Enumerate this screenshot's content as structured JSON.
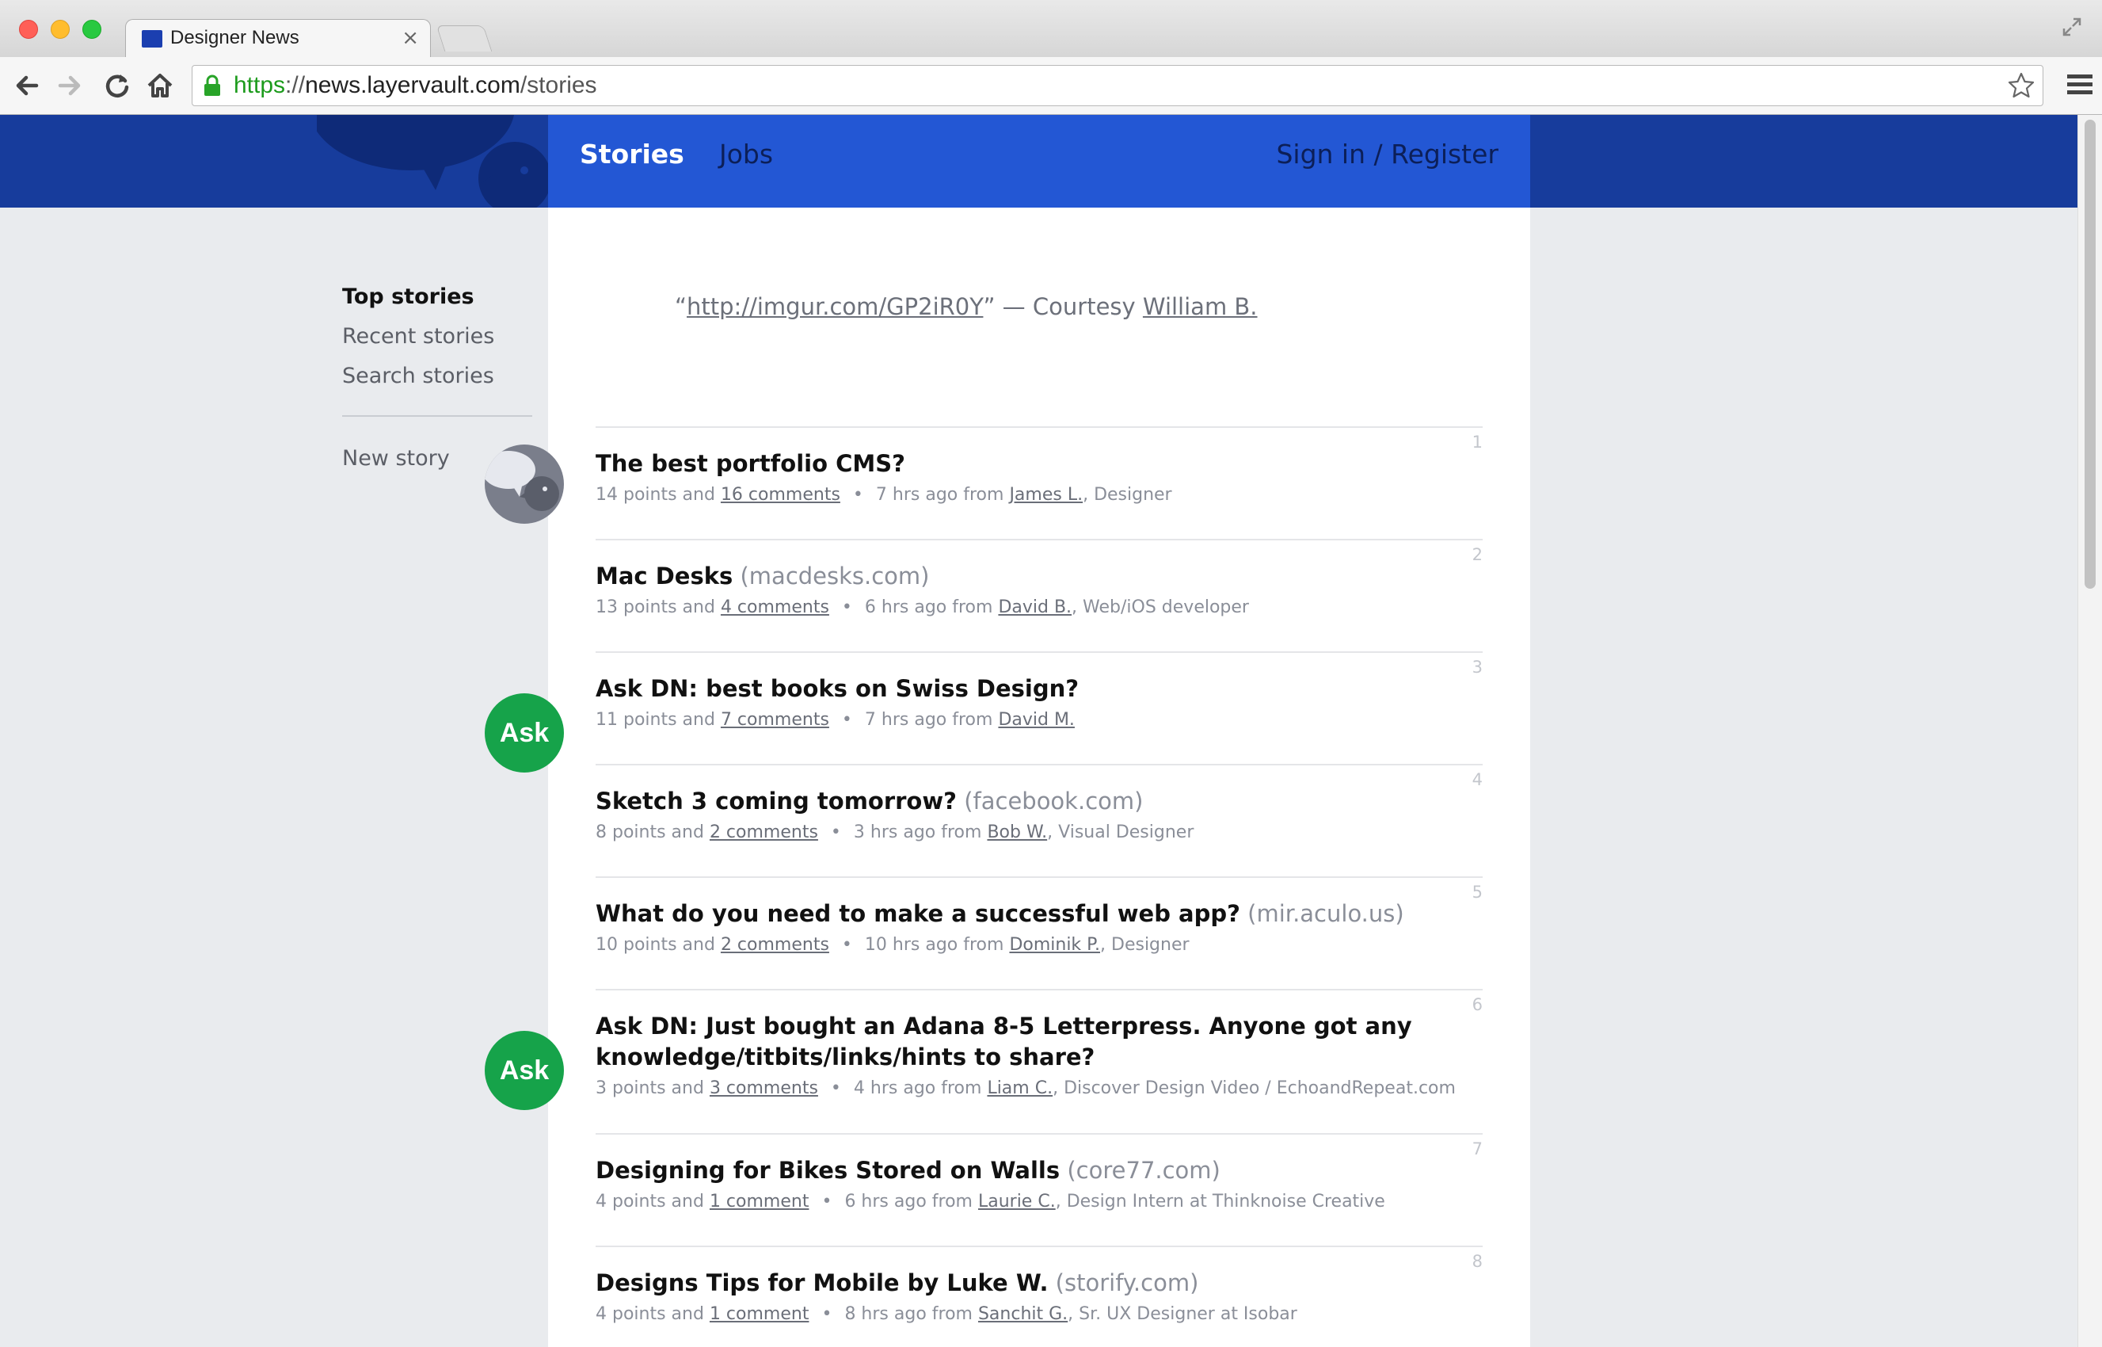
{
  "browser": {
    "tab_title": "Designer News",
    "tab_close": "×",
    "url_scheme": "https",
    "url_sep": "://",
    "url_host": "news.layervault.com",
    "url_path": "/stories"
  },
  "header": {
    "nav_stories": "Stories",
    "nav_jobs": "Jobs",
    "nav_signin": "Sign in / Register"
  },
  "sidebar": {
    "items": [
      "Top stories",
      "Recent stories",
      "Search stories"
    ],
    "new_story": "New story"
  },
  "quote": {
    "open": "“",
    "link": "http://imgur.com/GP2iR0Y",
    "close": "” — Courtesy ",
    "author": "William B."
  },
  "stories": [
    {
      "rank": "1",
      "title": "The best portfolio CMS?",
      "domain": "",
      "points": "14 points and ",
      "comments": "16 comments",
      "time": "7 hrs ago from ",
      "user": "James L.",
      "role": ", Designer",
      "avatar": "dn"
    },
    {
      "rank": "2",
      "title": "Mac Desks",
      "domain": "(macdesks.com)",
      "points": "13 points and ",
      "comments": "4 comments",
      "time": "6 hrs ago from ",
      "user": "David B.",
      "role": ", Web/iOS developer",
      "avatar": ""
    },
    {
      "rank": "3",
      "title": "Ask DN: best books on Swiss Design?",
      "domain": "",
      "points": "11 points and ",
      "comments": "7 comments",
      "time": "7 hrs ago from ",
      "user": "David M.",
      "role": "",
      "avatar": "ask"
    },
    {
      "rank": "4",
      "title": "Sketch 3 coming tomorrow?",
      "domain": "(facebook.com)",
      "points": "8 points and ",
      "comments": "2 comments",
      "time": "3 hrs ago from ",
      "user": "Bob W.",
      "role": ", Visual Designer",
      "avatar": ""
    },
    {
      "rank": "5",
      "title": "What do you need to make a successful web app?",
      "domain": "(mir.aculo.us)",
      "points": "10 points and ",
      "comments": "2 comments",
      "time": "10 hrs ago from ",
      "user": "Dominik P.",
      "role": ", Designer",
      "avatar": ""
    },
    {
      "rank": "6",
      "title": "Ask DN: Just bought an Adana 8-5 Letterpress. Anyone got any knowledge/titbits/links/hints to share?",
      "domain": "",
      "points": "3 points and ",
      "comments": "3 comments",
      "time": "4 hrs ago from ",
      "user": "Liam C.",
      "role": ", Discover Design Video / EchoandRepeat.com",
      "avatar": "ask"
    },
    {
      "rank": "7",
      "title": "Designing for Bikes Stored on Walls",
      "domain": "(core77.com)",
      "points": "4 points and ",
      "comments": "1 comment",
      "time": "6 hrs ago from ",
      "user": "Laurie C.",
      "role": ", Design Intern at Thinknoise Creative",
      "avatar": ""
    },
    {
      "rank": "8",
      "title": "Designs Tips for Mobile by Luke W.",
      "domain": "(storify.com)",
      "points": "4 points and ",
      "comments": "1 comment",
      "time": "8 hrs ago from ",
      "user": "Sanchit G.",
      "role": ", Sr. UX Designer at Isobar",
      "avatar": ""
    }
  ],
  "ask_label": "Ask",
  "meta_dot": "•",
  "colors": {
    "header_dark": "#173c9c",
    "header_nav": "#2357d4",
    "ask_green": "#16a34a"
  }
}
